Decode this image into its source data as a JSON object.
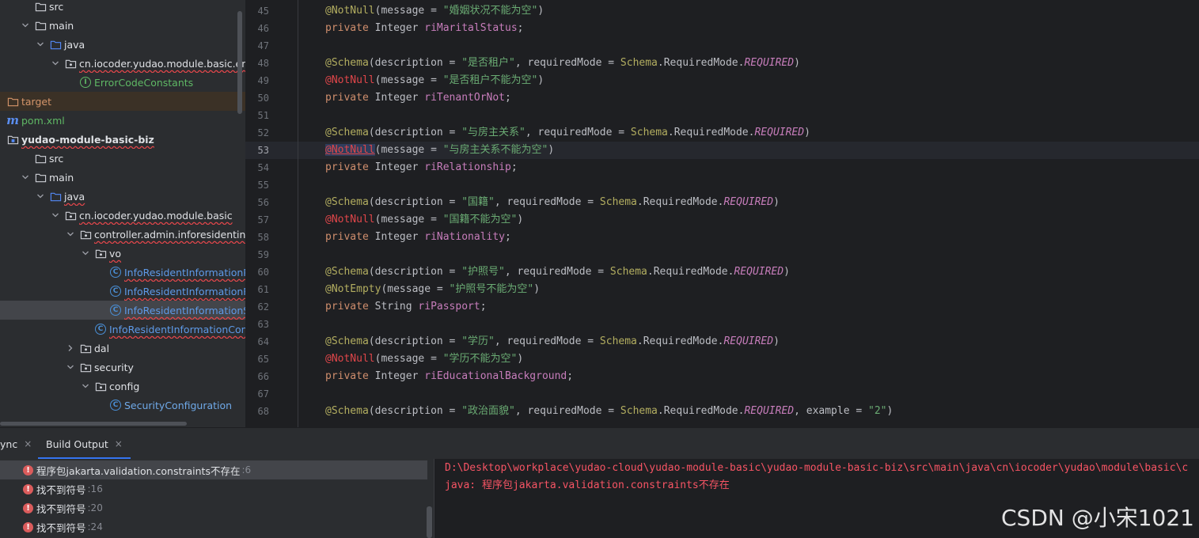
{
  "project_tree": {
    "rows": [
      {
        "label": "src",
        "indent": 1,
        "arrow": "",
        "icon": "folder",
        "style": ""
      },
      {
        "label": "main",
        "indent": 1,
        "arrow": "down",
        "icon": "folder",
        "style": ""
      },
      {
        "label": "java",
        "indent": 2,
        "arrow": "down",
        "icon": "source-folder",
        "style": ""
      },
      {
        "label": "cn.iocoder.yudao.module.basic.enums",
        "indent": 3,
        "arrow": "down",
        "icon": "package",
        "style": "err"
      },
      {
        "label": "ErrorCodeConstants",
        "indent": 4,
        "arrow": "",
        "icon": "interface",
        "style": "green"
      },
      {
        "label": "target",
        "indent": 0,
        "arrow": "",
        "icon": "folder-excluded",
        "style": "orange"
      },
      {
        "label": "pom.xml",
        "indent": 0,
        "arrow": "",
        "icon": "maven",
        "style": "green"
      },
      {
        "label": "yudao-module-basic-biz",
        "indent": 0,
        "arrow": "",
        "icon": "module",
        "style": "bold-err"
      },
      {
        "label": "src",
        "indent": 1,
        "arrow": "",
        "icon": "folder",
        "style": ""
      },
      {
        "label": "main",
        "indent": 1,
        "arrow": "down",
        "icon": "folder",
        "style": ""
      },
      {
        "label": "java",
        "indent": 2,
        "arrow": "down",
        "icon": "source-folder",
        "style": "err"
      },
      {
        "label": "cn.iocoder.yudao.module.basic",
        "indent": 3,
        "arrow": "down",
        "icon": "package",
        "style": "err"
      },
      {
        "label": "controller.admin.inforesidentinforma",
        "indent": 4,
        "arrow": "down",
        "icon": "package",
        "style": "err"
      },
      {
        "label": "vo",
        "indent": 5,
        "arrow": "down",
        "icon": "package",
        "style": "err"
      },
      {
        "label": "InfoResidentInformationPage",
        "indent": 6,
        "arrow": "",
        "icon": "class",
        "style": "red-err"
      },
      {
        "label": "InfoResidentInformationResp",
        "indent": 6,
        "arrow": "",
        "icon": "class",
        "style": "red-err"
      },
      {
        "label": "InfoResidentInformationSave",
        "indent": 6,
        "arrow": "",
        "icon": "class",
        "style": "red-err"
      },
      {
        "label": "InfoResidentInformationControll",
        "indent": 5,
        "arrow": "",
        "icon": "class",
        "style": "red-err"
      },
      {
        "label": "dal",
        "indent": 4,
        "arrow": "right",
        "icon": "package",
        "style": ""
      },
      {
        "label": "security",
        "indent": 4,
        "arrow": "down",
        "icon": "package",
        "style": ""
      },
      {
        "label": "config",
        "indent": 5,
        "arrow": "down",
        "icon": "package",
        "style": ""
      },
      {
        "label": "SecurityConfiguration",
        "indent": 6,
        "arrow": "",
        "icon": "class",
        "style": "blue"
      }
    ]
  },
  "editor": {
    "current_line": 53,
    "lines": [
      {
        "n": "45",
        "tokens": [
          [
            "anno",
            "@NotNull"
          ],
          [
            "",
            "(message = "
          ],
          [
            "str",
            "\"婚姻状况不能为空\""
          ],
          [
            "",
            ")"
          ]
        ]
      },
      {
        "n": "46",
        "tokens": [
          [
            "kw",
            "private "
          ],
          [
            "",
            "Integer "
          ],
          [
            "fld",
            "riMaritalStatus"
          ],
          [
            "",
            ";"
          ]
        ]
      },
      {
        "n": "47",
        "tokens": []
      },
      {
        "n": "48",
        "tokens": [
          [
            "anno",
            "@Schema"
          ],
          [
            "",
            "(description = "
          ],
          [
            "str",
            "\"是否租户\""
          ],
          [
            "",
            ", requiredMode = "
          ],
          [
            "cls",
            "Schema"
          ],
          [
            "",
            ".RequiredMode."
          ],
          [
            "enm",
            "REQUIRED"
          ],
          [
            "",
            ")"
          ]
        ]
      },
      {
        "n": "49",
        "tokens": [
          [
            "anno-ref",
            "@NotNull"
          ],
          [
            "",
            "(message = "
          ],
          [
            "str",
            "\"是否租户不能为空\""
          ],
          [
            "",
            ")"
          ]
        ]
      },
      {
        "n": "50",
        "tokens": [
          [
            "kw",
            "private "
          ],
          [
            "",
            "Integer "
          ],
          [
            "fld",
            "riTenantOrNot"
          ],
          [
            "",
            ";"
          ]
        ]
      },
      {
        "n": "51",
        "tokens": []
      },
      {
        "n": "52",
        "tokens": [
          [
            "anno",
            "@Schema"
          ],
          [
            "",
            "(description = "
          ],
          [
            "str",
            "\"与房主关系\""
          ],
          [
            "",
            ", requiredMode = "
          ],
          [
            "cls",
            "Schema"
          ],
          [
            "",
            ".RequiredMode."
          ],
          [
            "enm",
            "REQUIRED"
          ],
          [
            "",
            ")"
          ]
        ]
      },
      {
        "n": "53",
        "tokens": [
          [
            "anno-hl",
            "@NotNull"
          ],
          [
            "",
            "(message = "
          ],
          [
            "str",
            "\"与房主关系不能为空\""
          ],
          [
            "",
            ")"
          ]
        ]
      },
      {
        "n": "54",
        "tokens": [
          [
            "kw",
            "private "
          ],
          [
            "",
            "Integer "
          ],
          [
            "fld",
            "riRelationship"
          ],
          [
            "",
            ";"
          ]
        ]
      },
      {
        "n": "55",
        "tokens": []
      },
      {
        "n": "56",
        "tokens": [
          [
            "anno",
            "@Schema"
          ],
          [
            "",
            "(description = "
          ],
          [
            "str",
            "\"国籍\""
          ],
          [
            "",
            ", requiredMode = "
          ],
          [
            "cls",
            "Schema"
          ],
          [
            "",
            ".RequiredMode."
          ],
          [
            "enm",
            "REQUIRED"
          ],
          [
            "",
            ")"
          ]
        ]
      },
      {
        "n": "57",
        "tokens": [
          [
            "anno-ref",
            "@NotNull"
          ],
          [
            "",
            "(message = "
          ],
          [
            "str",
            "\"国籍不能为空\""
          ],
          [
            "",
            ")"
          ]
        ]
      },
      {
        "n": "58",
        "tokens": [
          [
            "kw",
            "private "
          ],
          [
            "",
            "Integer "
          ],
          [
            "fld",
            "riNationality"
          ],
          [
            "",
            ";"
          ]
        ]
      },
      {
        "n": "59",
        "tokens": []
      },
      {
        "n": "60",
        "tokens": [
          [
            "anno",
            "@Schema"
          ],
          [
            "",
            "(description = "
          ],
          [
            "str",
            "\"护照号\""
          ],
          [
            "",
            ", requiredMode = "
          ],
          [
            "cls",
            "Schema"
          ],
          [
            "",
            ".RequiredMode."
          ],
          [
            "enm",
            "REQUIRED"
          ],
          [
            "",
            ")"
          ]
        ]
      },
      {
        "n": "61",
        "tokens": [
          [
            "anno",
            "@NotEmpty"
          ],
          [
            "",
            "(message = "
          ],
          [
            "str",
            "\"护照号不能为空\""
          ],
          [
            "",
            ")"
          ]
        ]
      },
      {
        "n": "62",
        "tokens": [
          [
            "kw",
            "private "
          ],
          [
            "",
            "String "
          ],
          [
            "fld",
            "riPassport"
          ],
          [
            "",
            ";"
          ]
        ]
      },
      {
        "n": "63",
        "tokens": []
      },
      {
        "n": "64",
        "tokens": [
          [
            "anno",
            "@Schema"
          ],
          [
            "",
            "(description = "
          ],
          [
            "str",
            "\"学历\""
          ],
          [
            "",
            ", requiredMode = "
          ],
          [
            "cls",
            "Schema"
          ],
          [
            "",
            ".RequiredMode."
          ],
          [
            "enm",
            "REQUIRED"
          ],
          [
            "",
            ")"
          ]
        ]
      },
      {
        "n": "65",
        "tokens": [
          [
            "anno-ref",
            "@NotNull"
          ],
          [
            "",
            "(message = "
          ],
          [
            "str",
            "\"学历不能为空\""
          ],
          [
            "",
            ")"
          ]
        ]
      },
      {
        "n": "66",
        "tokens": [
          [
            "kw",
            "private "
          ],
          [
            "",
            "Integer "
          ],
          [
            "fld",
            "riEducationalBackground"
          ],
          [
            "",
            ";"
          ]
        ]
      },
      {
        "n": "67",
        "tokens": []
      },
      {
        "n": "68",
        "tokens": [
          [
            "anno",
            "@Schema"
          ],
          [
            "",
            "(description = "
          ],
          [
            "str",
            "\"政治面貌\""
          ],
          [
            "",
            ", requiredMode = "
          ],
          [
            "cls",
            "Schema"
          ],
          [
            "",
            ".RequiredMode."
          ],
          [
            "enm",
            "REQUIRED"
          ],
          [
            "",
            ", example = "
          ],
          [
            "str",
            "\"2\""
          ],
          [
            "",
            ")"
          ]
        ]
      }
    ]
  },
  "bottom_panel": {
    "tabs": [
      {
        "label": "ync",
        "close": "×"
      },
      {
        "label": "Build Output",
        "close": "×"
      }
    ],
    "errors": [
      {
        "message": "程序包jakarta.validation.constraints不存在",
        "location": ":6"
      },
      {
        "message": "找不到符号",
        "location": ":16"
      },
      {
        "message": "找不到符号",
        "location": ":20"
      },
      {
        "message": "找不到符号",
        "location": ":24"
      }
    ],
    "console": [
      "D:\\Desktop\\workplace\\yudao-cloud\\yudao-module-basic\\yudao-module-basic-biz\\src\\main\\java\\cn\\iocoder\\yudao\\module\\basic\\c",
      "java: 程序包jakarta.validation.constraints不存在"
    ]
  },
  "watermark": "CSDN @小宋1021",
  "colors": {
    "panel_bg": "#2b2d30",
    "editor_bg": "#1e1f22",
    "error_red": "#db5c5c",
    "accent_blue": "#3574f0"
  }
}
